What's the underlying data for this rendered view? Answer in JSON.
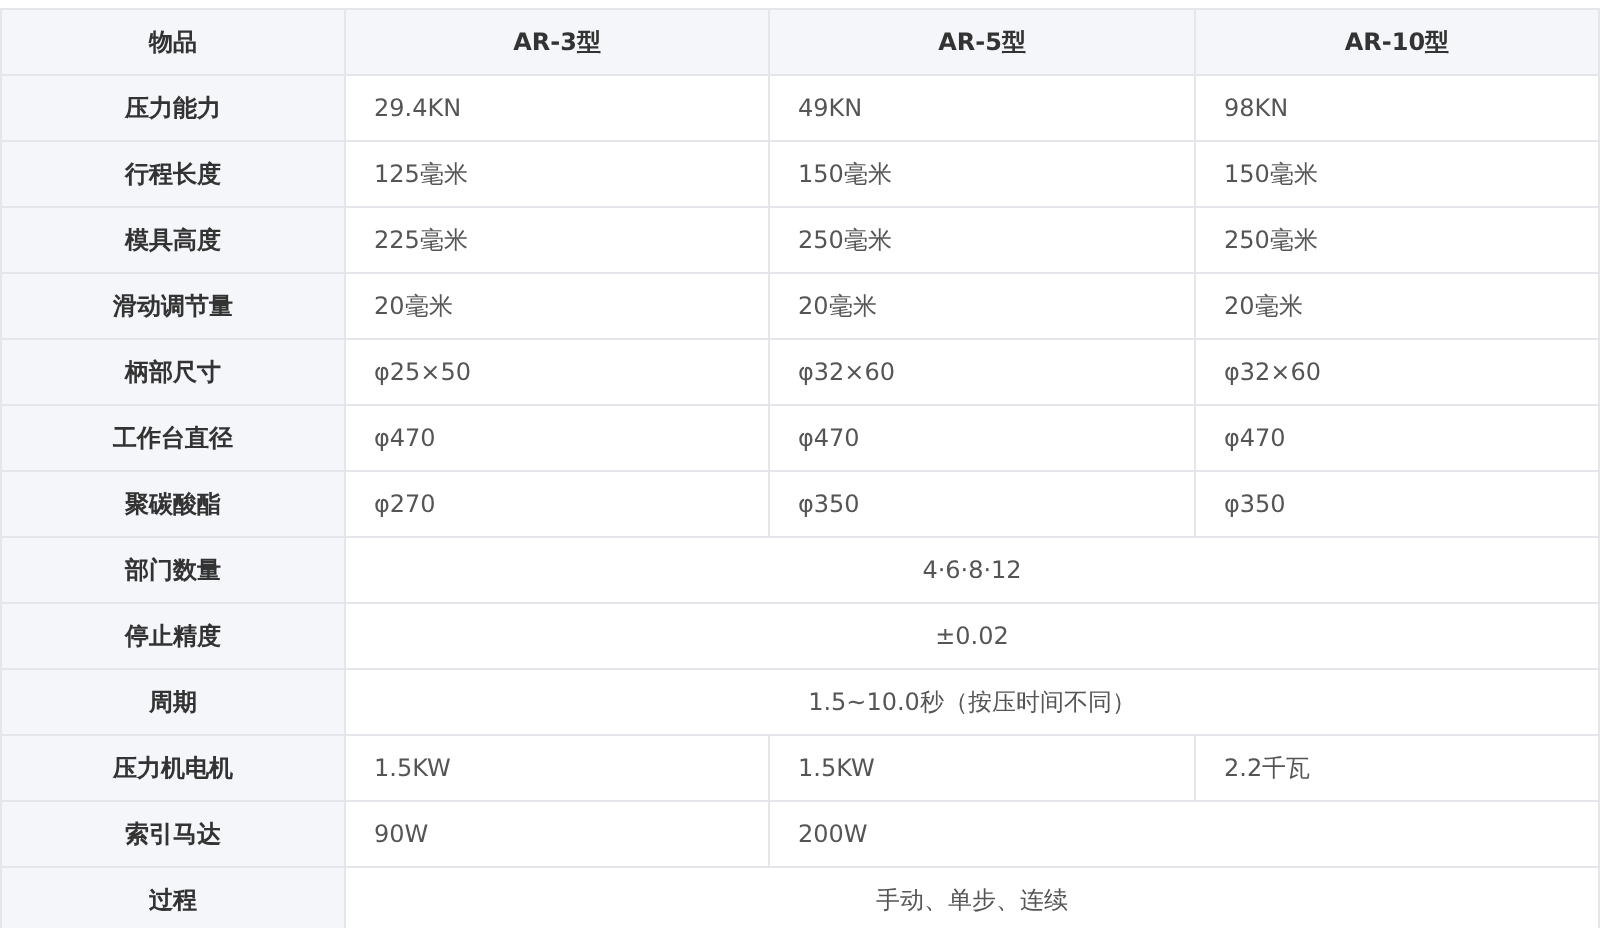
{
  "table": {
    "columns": [
      "物品",
      "AR-3型",
      "AR-5型",
      "AR-10型"
    ],
    "rows": [
      {
        "label": "压力能力",
        "values": [
          "29.4KN",
          "49KN",
          "98KN"
        ]
      },
      {
        "label": "行程长度",
        "values": [
          "125毫米",
          "150毫米",
          "150毫米"
        ]
      },
      {
        "label": "模具高度",
        "values": [
          "225毫米",
          "250毫米",
          "250毫米"
        ]
      },
      {
        "label": "滑动调节量",
        "values": [
          "20毫米",
          "20毫米",
          "20毫米"
        ]
      },
      {
        "label": "柄部尺寸",
        "values": [
          "φ25×50",
          "φ32×60",
          "φ32×60"
        ]
      },
      {
        "label": "工作台直径",
        "values": [
          "φ470",
          "φ470",
          "φ470"
        ]
      },
      {
        "label": "聚碳酸酯",
        "values": [
          "φ270",
          "φ350",
          "φ350"
        ]
      },
      {
        "label": "部门数量",
        "values": [
          "4·6·8·12"
        ]
      },
      {
        "label": "停止精度",
        "values": [
          "±0.02"
        ]
      },
      {
        "label": "周期",
        "values": [
          "1.5~10.0秒（按压时间不同）"
        ]
      },
      {
        "label": "压力机电机",
        "values": [
          "1.5KW",
          "1.5KW",
          "2.2千瓦"
        ]
      },
      {
        "label": "索引马达",
        "values": [
          "90W",
          "200W"
        ]
      },
      {
        "label": "过程",
        "values": [
          "手动、单步、连续"
        ]
      }
    ]
  }
}
